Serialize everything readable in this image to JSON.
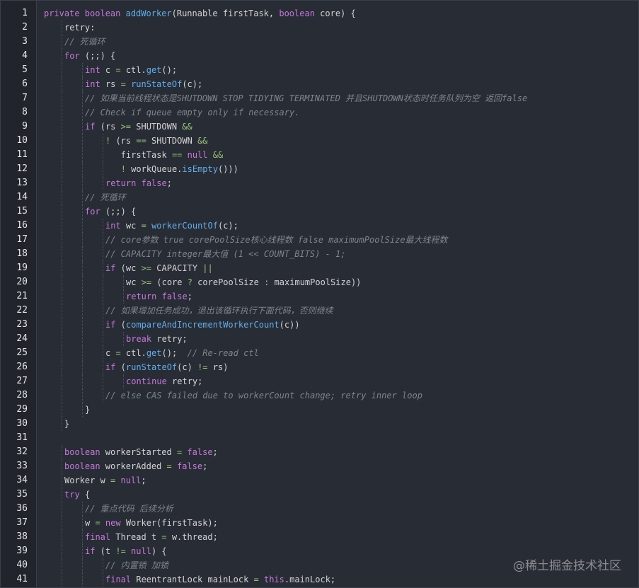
{
  "watermark": "@稀土掘金技术社区",
  "lines": [
    {
      "n": "1",
      "i": 0,
      "t": [
        [
          "k",
          "private boolean "
        ],
        [
          "f",
          "addWorker"
        ],
        [
          "p",
          "(Runnable firstTask, "
        ],
        [
          "k",
          "boolean"
        ],
        [
          "p",
          " core) {"
        ]
      ]
    },
    {
      "n": "2",
      "i": 1,
      "t": [
        [
          "p",
          "retry:"
        ]
      ]
    },
    {
      "n": "3",
      "i": 1,
      "t": [
        [
          "c",
          "// 死循环"
        ]
      ]
    },
    {
      "n": "4",
      "i": 1,
      "t": [
        [
          "k",
          "for"
        ],
        [
          "p",
          " (;;) {"
        ]
      ]
    },
    {
      "n": "5",
      "i": 2,
      "t": [
        [
          "k",
          "int"
        ],
        [
          "p",
          " c "
        ],
        [
          "o",
          "="
        ],
        [
          "p",
          " ctl."
        ],
        [
          "f",
          "get"
        ],
        [
          "p",
          "();"
        ]
      ]
    },
    {
      "n": "6",
      "i": 2,
      "t": [
        [
          "k",
          "int"
        ],
        [
          "p",
          " rs "
        ],
        [
          "o",
          "="
        ],
        [
          "p",
          " "
        ],
        [
          "f",
          "runStateOf"
        ],
        [
          "p",
          "(c);"
        ]
      ]
    },
    {
      "n": "7",
      "i": 2,
      "t": [
        [
          "c",
          "// 如果当前线程状态是SHUTDOWN STOP TIDYING TERMINATED 并且SHUTDOWN状态时任务队列为空 返回false"
        ]
      ]
    },
    {
      "n": "8",
      "i": 2,
      "t": [
        [
          "c",
          "// Check if queue empty only if necessary."
        ]
      ]
    },
    {
      "n": "9",
      "i": 2,
      "t": [
        [
          "k",
          "if"
        ],
        [
          "p",
          " (rs "
        ],
        [
          "o",
          ">="
        ],
        [
          "p",
          " SHUTDOWN "
        ],
        [
          "o",
          "&&"
        ]
      ]
    },
    {
      "n": "10",
      "i": 3,
      "t": [
        [
          "o",
          "!"
        ],
        [
          "p",
          " (rs "
        ],
        [
          "o",
          "=="
        ],
        [
          "p",
          " SHUTDOWN "
        ],
        [
          "o",
          "&&"
        ]
      ]
    },
    {
      "n": "11",
      "i": 3,
      "e": "   ",
      "t": [
        [
          "p",
          "firstTask "
        ],
        [
          "o",
          "=="
        ],
        [
          "p",
          " "
        ],
        [
          "l",
          "null"
        ],
        [
          "p",
          " "
        ],
        [
          "o",
          "&&"
        ]
      ]
    },
    {
      "n": "12",
      "i": 3,
      "e": "   ",
      "t": [
        [
          "o",
          "!"
        ],
        [
          "p",
          " workQueue."
        ],
        [
          "f",
          "isEmpty"
        ],
        [
          "p",
          "()))"
        ]
      ]
    },
    {
      "n": "13",
      "i": 3,
      "t": [
        [
          "k",
          "return"
        ],
        [
          "p",
          " "
        ],
        [
          "l",
          "false"
        ],
        [
          "p",
          ";"
        ]
      ]
    },
    {
      "n": "14",
      "i": 2,
      "t": [
        [
          "c",
          "// 死循环"
        ]
      ]
    },
    {
      "n": "15",
      "i": 2,
      "t": [
        [
          "k",
          "for"
        ],
        [
          "p",
          " (;;) {"
        ]
      ]
    },
    {
      "n": "16",
      "i": 3,
      "t": [
        [
          "k",
          "int"
        ],
        [
          "p",
          " wc "
        ],
        [
          "o",
          "="
        ],
        [
          "p",
          " "
        ],
        [
          "f",
          "workerCountOf"
        ],
        [
          "p",
          "(c);"
        ]
      ]
    },
    {
      "n": "17",
      "i": 3,
      "t": [
        [
          "c",
          "// core参数 true corePoolSize核心线程数 false maximumPoolSize最大线程数"
        ]
      ]
    },
    {
      "n": "18",
      "i": 3,
      "t": [
        [
          "c",
          "// CAPACITY integer最大值 (1 << COUNT_BITS) - 1;"
        ]
      ]
    },
    {
      "n": "19",
      "i": 3,
      "t": [
        [
          "k",
          "if"
        ],
        [
          "p",
          " (wc "
        ],
        [
          "o",
          ">="
        ],
        [
          "p",
          " CAPACITY "
        ],
        [
          "o",
          "||"
        ]
      ]
    },
    {
      "n": "20",
      "i": 4,
      "t": [
        [
          "p",
          "wc "
        ],
        [
          "o",
          ">="
        ],
        [
          "p",
          " (core "
        ],
        [
          "o",
          "?"
        ],
        [
          "p",
          " corePoolSize "
        ],
        [
          "o",
          ":"
        ],
        [
          "p",
          " maximumPoolSize))"
        ]
      ]
    },
    {
      "n": "21",
      "i": 4,
      "t": [
        [
          "k",
          "return"
        ],
        [
          "p",
          " "
        ],
        [
          "l",
          "false"
        ],
        [
          "p",
          ";"
        ]
      ]
    },
    {
      "n": "22",
      "i": 3,
      "t": [
        [
          "c",
          "// 如果增加任务成功，退出该循环执行下面代码，否则继续"
        ]
      ]
    },
    {
      "n": "23",
      "i": 3,
      "t": [
        [
          "k",
          "if"
        ],
        [
          "p",
          " ("
        ],
        [
          "f",
          "compareAndIncrementWorkerCount"
        ],
        [
          "p",
          "(c))"
        ]
      ]
    },
    {
      "n": "24",
      "i": 4,
      "t": [
        [
          "k",
          "break"
        ],
        [
          "p",
          " retry;"
        ]
      ]
    },
    {
      "n": "25",
      "i": 3,
      "t": [
        [
          "p",
          "c "
        ],
        [
          "o",
          "="
        ],
        [
          "p",
          " ctl."
        ],
        [
          "f",
          "get"
        ],
        [
          "p",
          "();  "
        ],
        [
          "c",
          "// Re-read ctl"
        ]
      ]
    },
    {
      "n": "26",
      "i": 3,
      "t": [
        [
          "k",
          "if"
        ],
        [
          "p",
          " ("
        ],
        [
          "f",
          "runStateOf"
        ],
        [
          "p",
          "(c) "
        ],
        [
          "o",
          "!="
        ],
        [
          "p",
          " rs)"
        ]
      ]
    },
    {
      "n": "27",
      "i": 4,
      "t": [
        [
          "k",
          "continue"
        ],
        [
          "p",
          " retry;"
        ]
      ]
    },
    {
      "n": "28",
      "i": 3,
      "t": [
        [
          "c",
          "// else CAS failed due to workerCount change; retry inner loop"
        ]
      ]
    },
    {
      "n": "29",
      "i": 2,
      "t": [
        [
          "p",
          "}"
        ]
      ]
    },
    {
      "n": "30",
      "i": 1,
      "t": [
        [
          "p",
          "}"
        ]
      ]
    },
    {
      "n": "31",
      "i": 0,
      "t": []
    },
    {
      "n": "32",
      "i": 1,
      "t": [
        [
          "k",
          "boolean"
        ],
        [
          "p",
          " workerStarted "
        ],
        [
          "o",
          "="
        ],
        [
          "p",
          " "
        ],
        [
          "l",
          "false"
        ],
        [
          "p",
          ";"
        ]
      ]
    },
    {
      "n": "33",
      "i": 1,
      "t": [
        [
          "k",
          "boolean"
        ],
        [
          "p",
          " workerAdded "
        ],
        [
          "o",
          "="
        ],
        [
          "p",
          " "
        ],
        [
          "l",
          "false"
        ],
        [
          "p",
          ";"
        ]
      ]
    },
    {
      "n": "34",
      "i": 1,
      "t": [
        [
          "p",
          "Worker w "
        ],
        [
          "o",
          "="
        ],
        [
          "p",
          " "
        ],
        [
          "l",
          "null"
        ],
        [
          "p",
          ";"
        ]
      ]
    },
    {
      "n": "35",
      "i": 1,
      "t": [
        [
          "k",
          "try"
        ],
        [
          "p",
          " {"
        ]
      ]
    },
    {
      "n": "36",
      "i": 2,
      "t": [
        [
          "c",
          "// 重点代码 后续分析"
        ]
      ]
    },
    {
      "n": "37",
      "i": 2,
      "t": [
        [
          "p",
          "w "
        ],
        [
          "o",
          "="
        ],
        [
          "p",
          " "
        ],
        [
          "k",
          "new"
        ],
        [
          "p",
          " Worker(firstTask);"
        ]
      ]
    },
    {
      "n": "38",
      "i": 2,
      "t": [
        [
          "k",
          "final"
        ],
        [
          "p",
          " Thread t "
        ],
        [
          "o",
          "="
        ],
        [
          "p",
          " w.thread;"
        ]
      ]
    },
    {
      "n": "39",
      "i": 2,
      "t": [
        [
          "k",
          "if"
        ],
        [
          "p",
          " (t "
        ],
        [
          "o",
          "!="
        ],
        [
          "p",
          " "
        ],
        [
          "l",
          "null"
        ],
        [
          "p",
          ") {"
        ]
      ]
    },
    {
      "n": "40",
      "i": 3,
      "t": [
        [
          "c",
          "// 内置锁 加锁"
        ]
      ]
    },
    {
      "n": "41",
      "i": 3,
      "t": [
        [
          "k",
          "final"
        ],
        [
          "p",
          " ReentrantLock mainLock "
        ],
        [
          "o",
          "="
        ],
        [
          "p",
          " "
        ],
        [
          "k",
          "this"
        ],
        [
          "p",
          ".mainLock;"
        ]
      ]
    }
  ]
}
